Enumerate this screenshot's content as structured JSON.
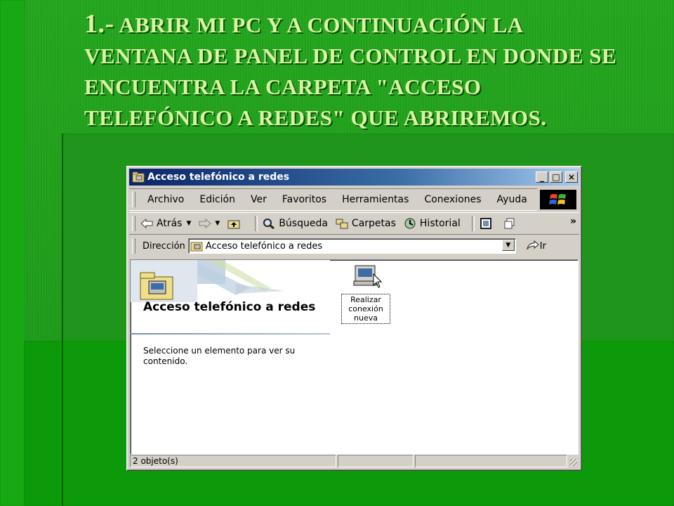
{
  "slide": {
    "title_lead": "1.-",
    "title_rest": " ABRIR MI PC Y A CONTINUACIÓN LA VENTANA DE PANEL DE CONTROL EN DONDE SE ENCUENTRA LA CARPETA \"ACCESO TELEFÓNICO A REDES\" QUE ABRIREMOS."
  },
  "window": {
    "title": "Acceso telefónico a redes",
    "buttons": {
      "minimize": "_",
      "maximize": "□",
      "close": "×"
    }
  },
  "menubar": {
    "items": [
      "Archivo",
      "Edición",
      "Ver",
      "Favoritos",
      "Herramientas",
      "Conexiones",
      "Ayuda"
    ]
  },
  "toolbar": {
    "back_label": "Atrás",
    "search_label": "Búsqueda",
    "folders_label": "Carpetas",
    "history_label": "Historial",
    "more": "»"
  },
  "address": {
    "label": "Dirección",
    "value": "Acceso telefónico a redes",
    "go_label": "Ir"
  },
  "content": {
    "panel_title": "Acceso telefónico a redes",
    "panel_desc": "Seleccione un elemento para ver su contenido.",
    "item_label": "Realizar conexión nueva"
  },
  "statusbar": {
    "objects": "2 objeto(s)"
  },
  "colors": {
    "slide_bg": "#1e9a1a",
    "title_text": "#d7f5a0",
    "titlebar_start": "#0a246a",
    "titlebar_end": "#a6caf0",
    "chrome": "#d4d0c8"
  }
}
